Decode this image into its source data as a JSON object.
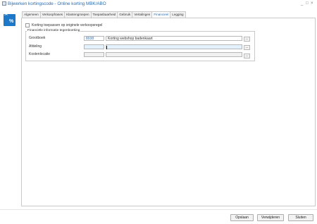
{
  "window": {
    "title": "Bijwerken kortingscode - Online korting MBK/ABO",
    "minimize_label": "_",
    "maximize_label": "□",
    "close_label": "×"
  },
  "side_icon": {
    "symbol": "%",
    "icon": "scissors-percent-icon",
    "color": "#1e78c8"
  },
  "tabs": [
    {
      "label": "Algemeen"
    },
    {
      "label": "Verkoopfrases"
    },
    {
      "label": "Klantengroepen"
    },
    {
      "label": "Toepasbaarheid"
    },
    {
      "label": "Gebruik"
    },
    {
      "label": "Vertalingen"
    },
    {
      "label": "Financieel"
    },
    {
      "label": "Legging"
    }
  ],
  "active_tab": "Financieel",
  "checkbox": {
    "label": "Korting toepassen op originele verkoopsregel",
    "checked": false
  },
  "group": {
    "title": "Financiële informatie tegenboeking",
    "rows": [
      {
        "label": "Grootboek",
        "code": "8038",
        "description": "Korting webshop badenkaart",
        "button": "..."
      },
      {
        "label": "Afdeling",
        "code": "",
        "description": "",
        "button": "..."
      },
      {
        "label": "Kostenlocatie",
        "code": "",
        "description": "",
        "button": "..."
      }
    ]
  },
  "buttons": {
    "save": "Opslaan",
    "delete": "Verwijderen",
    "close": "Sluiten"
  },
  "colors": {
    "accent": "#2b6cb0",
    "field_highlight": "#e2f1fb"
  }
}
